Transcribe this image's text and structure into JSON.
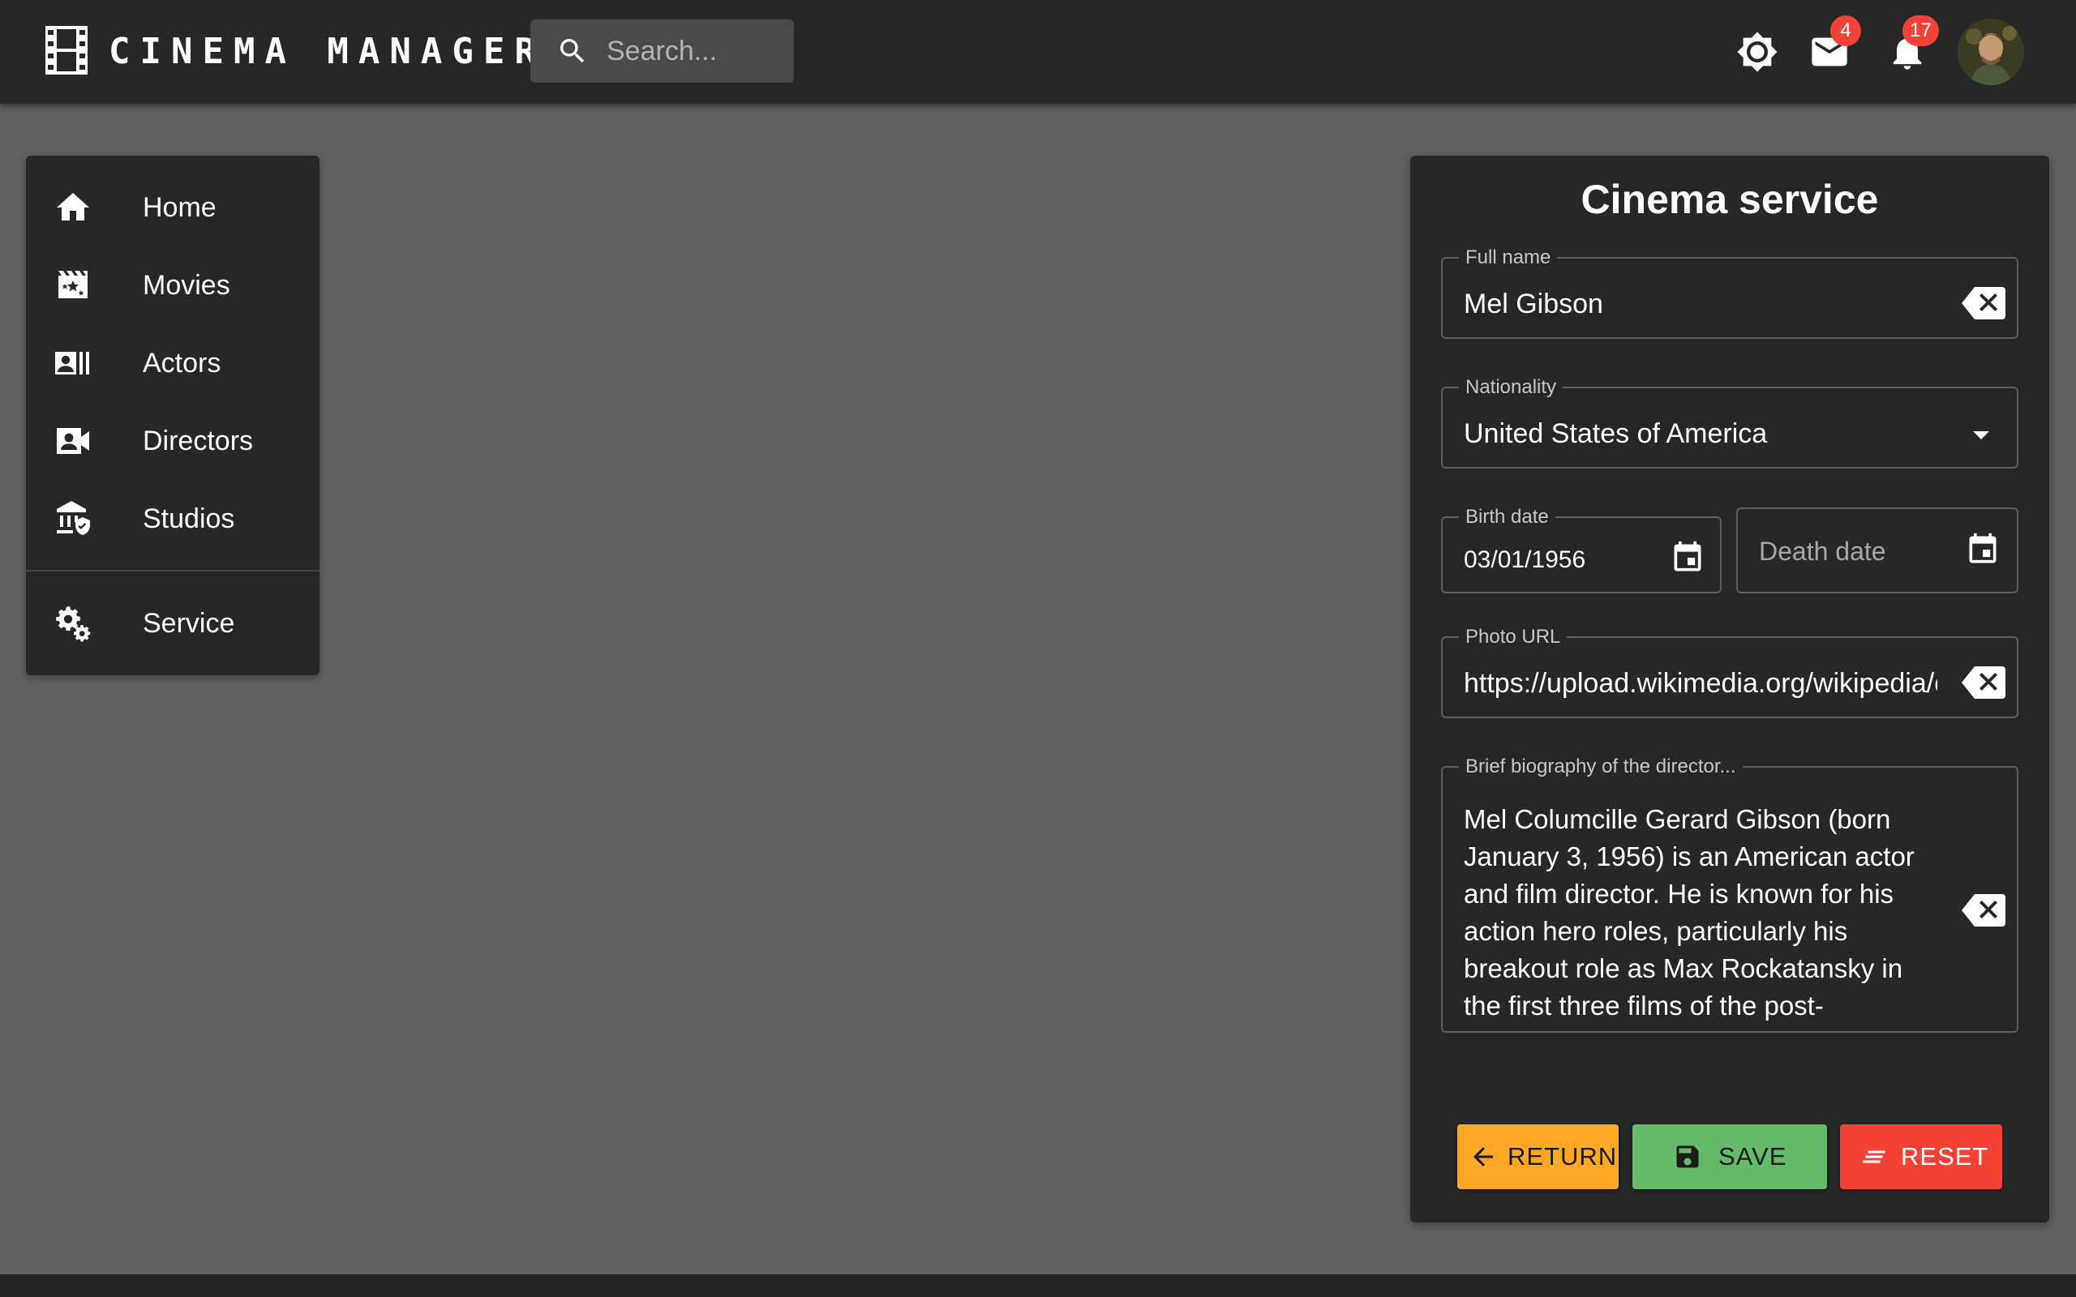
{
  "app": {
    "title": "CINEMA MANAGER",
    "search_placeholder": "Search..."
  },
  "header": {
    "mail_count": "4",
    "notification_count": "17",
    "icons": [
      "theme-toggle-icon",
      "mail-icon",
      "bell-icon"
    ]
  },
  "sidebar": {
    "items": [
      {
        "label": "Home",
        "icon": "home-icon"
      },
      {
        "label": "Movies",
        "icon": "movies-icon"
      },
      {
        "label": "Actors",
        "icon": "actors-icon"
      },
      {
        "label": "Directors",
        "icon": "directors-icon"
      },
      {
        "label": "Studios",
        "icon": "studios-icon"
      },
      {
        "label": "Service",
        "icon": "service-icon"
      }
    ]
  },
  "form": {
    "title": "Cinema service",
    "full_name": {
      "label": "Full name",
      "value": "Mel Gibson"
    },
    "nationality": {
      "label": "Nationality",
      "value": "United States of America"
    },
    "birth_date": {
      "label": "Birth date",
      "value": "03/01/1956"
    },
    "death_date": {
      "placeholder": "Death date"
    },
    "photo_url": {
      "label": "Photo URL",
      "value": "https://upload.wikimedia.org/wikipedia/cc"
    },
    "biography": {
      "label": "Brief biography of the director...",
      "value": "Mel Columcille Gerard Gibson (born\nJanuary 3, 1956) is an American actor\nand film director. He is known for his\naction hero roles, particularly his\nbreakout role as Max Rockatansky in\nthe first three films of the post-"
    },
    "buttons": {
      "return_label": "RETURN",
      "save_label": "SAVE",
      "reset_label": "RESET"
    }
  },
  "colors": {
    "background": "#616161",
    "surface": "#272727",
    "return": "#ffa726",
    "save": "#66bb6a",
    "reset": "#f44336",
    "badge": "#f44336"
  }
}
